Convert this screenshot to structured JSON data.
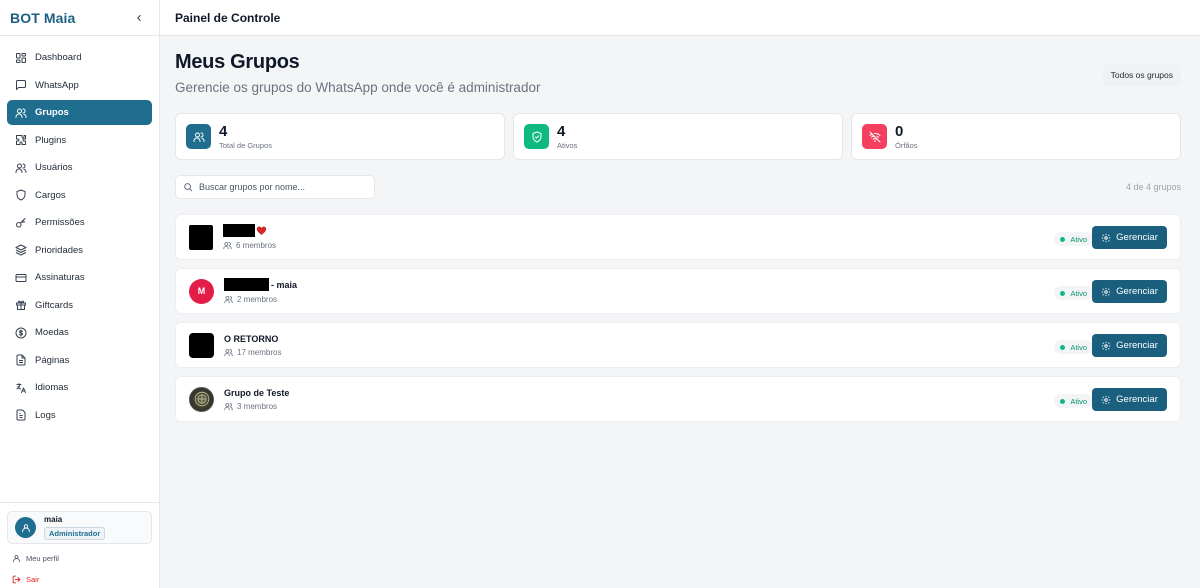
{
  "sidebar": {
    "brand": "BOT Maia",
    "items": [
      {
        "label": "Dashboard",
        "icon": "dashboard-icon"
      },
      {
        "label": "WhatsApp",
        "icon": "message-icon"
      },
      {
        "label": "Grupos",
        "icon": "users-icon",
        "active": true
      },
      {
        "label": "Plugins",
        "icon": "puzzle-icon"
      },
      {
        "label": "Usuários",
        "icon": "user-icon"
      },
      {
        "label": "Cargos",
        "icon": "shield-icon"
      },
      {
        "label": "Permissões",
        "icon": "key-icon"
      },
      {
        "label": "Prioridades",
        "icon": "layers-icon"
      },
      {
        "label": "Assinaturas",
        "icon": "card-icon"
      },
      {
        "label": "Giftcards",
        "icon": "gift-icon"
      },
      {
        "label": "Moedas",
        "icon": "coin-icon"
      },
      {
        "label": "Páginas",
        "icon": "file-icon"
      },
      {
        "label": "Idiomas",
        "icon": "language-icon"
      },
      {
        "label": "Logs",
        "icon": "log-icon"
      }
    ],
    "user": {
      "name": "maia",
      "role": "Administrador"
    },
    "profile_label": "Meu perfil",
    "logout_label": "Sair"
  },
  "header": {
    "title": "Painel de Controle"
  },
  "page": {
    "title": "Meus Grupos",
    "subtitle": "Gerencie os grupos do WhatsApp onde você é administrador",
    "filter_label": "Todos os grupos"
  },
  "stats": [
    {
      "value": "4",
      "label": "Total de Grupos",
      "color": "#1f6e90"
    },
    {
      "value": "4",
      "label": "Ativos",
      "color": "#10b981"
    },
    {
      "value": "0",
      "label": "Órfãos",
      "color": "#f43f5e"
    }
  ],
  "search": {
    "placeholder": "Buscar grupos por nome..."
  },
  "count_text": "4 de 4 grupos",
  "groups": [
    {
      "name": "",
      "members": "6 membros",
      "status": "Ativo",
      "action": "Gerenciar"
    },
    {
      "name": "- maia",
      "members": "2 membros",
      "status": "Ativo",
      "action": "Gerenciar",
      "initial": "M"
    },
    {
      "name": "O RETORNO",
      "members": "17 membros",
      "status": "Ativo",
      "action": "Gerenciar"
    },
    {
      "name": "Grupo de Teste",
      "members": "3 membros",
      "status": "Ativo",
      "action": "Gerenciar"
    }
  ],
  "colors": {
    "accent": "#1f6e90",
    "button": "#1b5f7f",
    "active_status": "#10b981",
    "danger": "#dc2626"
  }
}
